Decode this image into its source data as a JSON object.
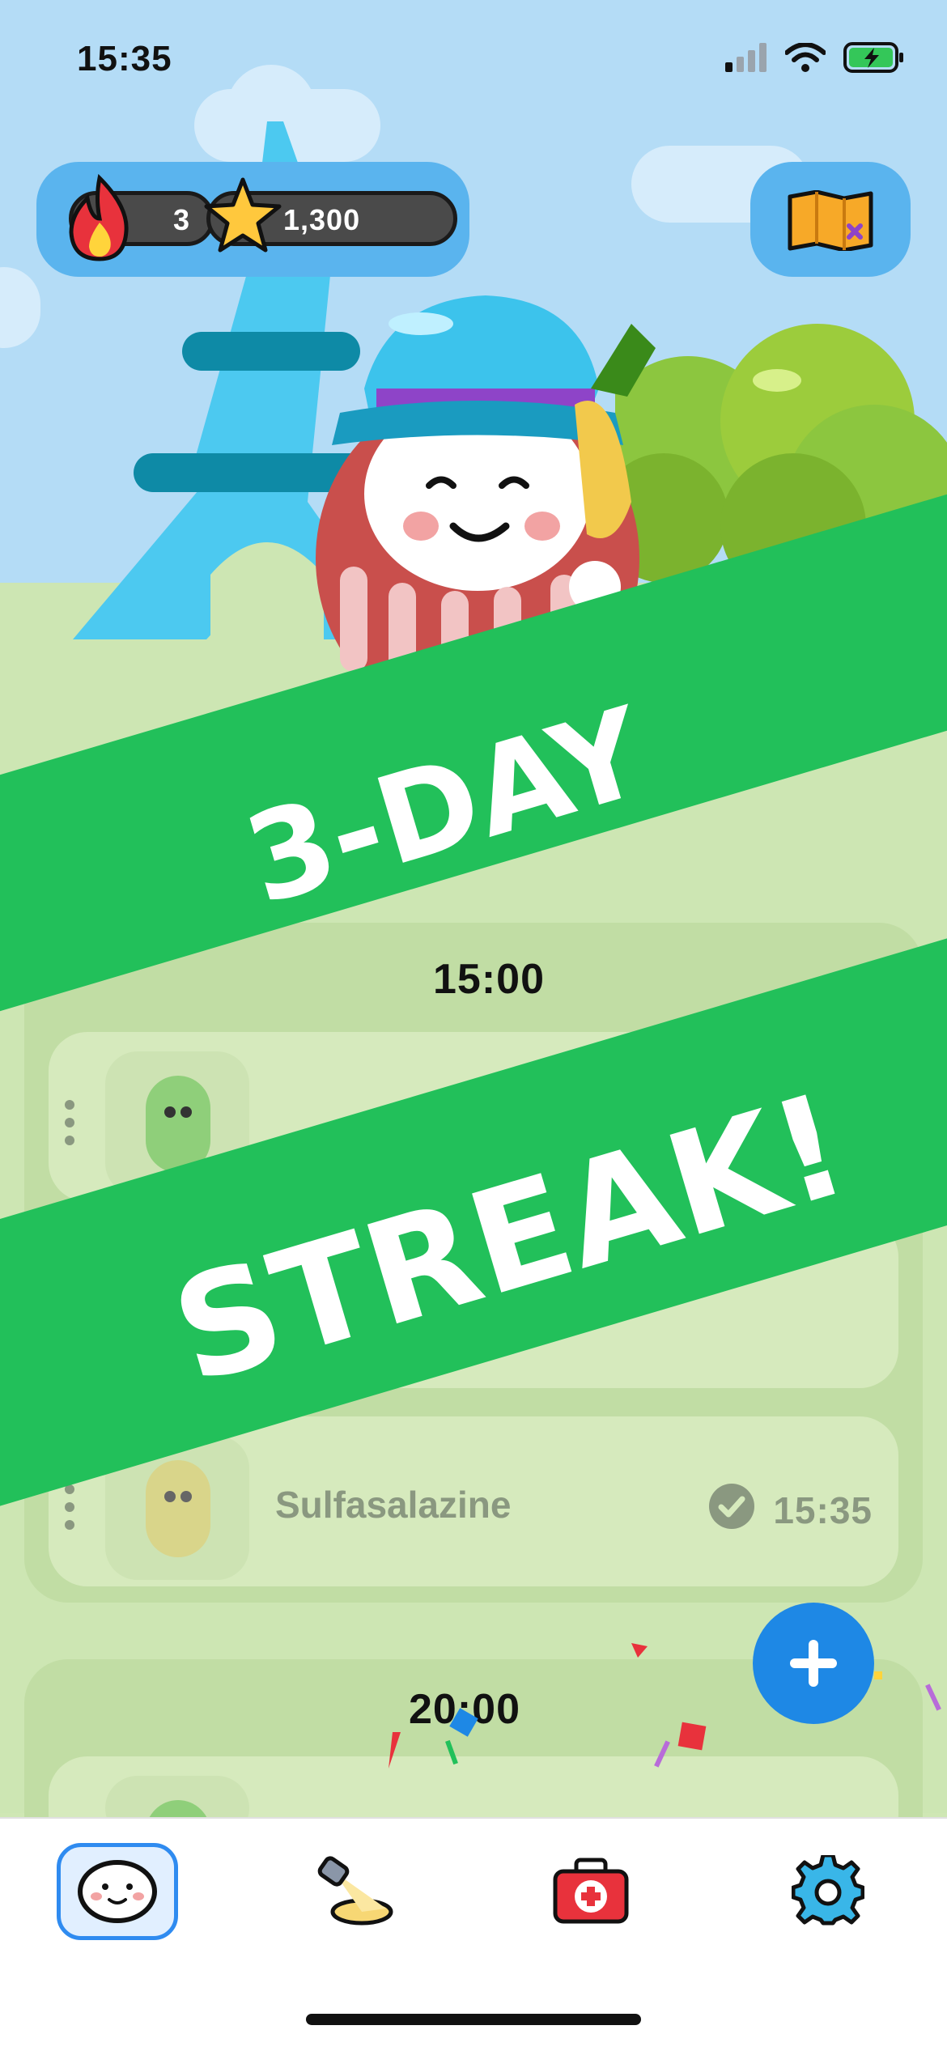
{
  "status_bar": {
    "time": "15:35"
  },
  "header": {
    "streak_count": "3",
    "stars_count": "1,300"
  },
  "banner": {
    "line1": "3-DAY",
    "line2": "STREAK!"
  },
  "schedule": {
    "groups": [
      {
        "time": "15:00",
        "medications": [
          {
            "name": "Sulfasalazine",
            "time": "15:35"
          }
        ]
      },
      {
        "time": "20:00"
      }
    ]
  },
  "tabs": [
    {
      "icon": "daruma-face-icon"
    },
    {
      "icon": "spotlight-icon"
    },
    {
      "icon": "first-aid-kit-icon"
    },
    {
      "icon": "gear-icon"
    }
  ],
  "colors": {
    "banner_green": "#22c05a",
    "fab_blue": "#1e88e5",
    "sky": "#b4dcf6"
  }
}
